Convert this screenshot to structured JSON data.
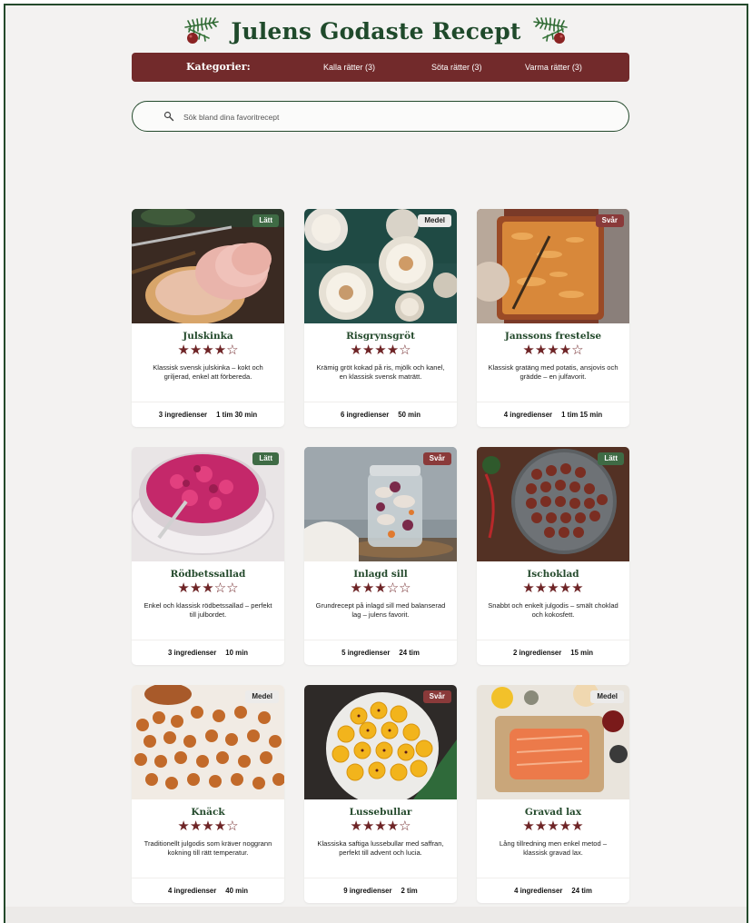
{
  "header": {
    "title": "Julens Godaste Recept"
  },
  "categories": {
    "label": "Kategorier:",
    "items": [
      {
        "label": "Kalla rätter (3)"
      },
      {
        "label": "Söta rätter (3)"
      },
      {
        "label": "Varma rätter (3)"
      }
    ]
  },
  "search": {
    "placeholder": "Sök bland dina favoritrecept",
    "value": ""
  },
  "colors": {
    "green": "#1f4a2b",
    "burgundy": "#722a2b",
    "badge_easy": "#3f6b45",
    "badge_hard": "#8a3a3a"
  },
  "recipes": [
    {
      "name": "Julskinka",
      "difficulty": "Lätt",
      "rating": 4,
      "stars": "★★★★☆",
      "description": "Klassisk svensk julskinka – kokt och griljerad, enkel att förbereda.",
      "ingredients": "3 ingredienser",
      "time": "1 tim 30 min",
      "image": "ham"
    },
    {
      "name": "Risgrynsgröt",
      "difficulty": "Medel",
      "rating": 4,
      "stars": "★★★★☆",
      "description": "Krämig gröt kokad på ris, mjölk och kanel, en klassisk svensk maträtt.",
      "ingredients": "6 ingredienser",
      "time": "50 min",
      "image": "porridge"
    },
    {
      "name": "Janssons frestelse",
      "difficulty": "Svår",
      "rating": 4,
      "stars": "★★★★☆",
      "description": "Klassisk gratäng med potatis, ansjovis och grädde – en julfavorit.",
      "ingredients": "4 ingredienser",
      "time": "1 tim 15 min",
      "image": "gratin"
    },
    {
      "name": "Rödbetssallad",
      "difficulty": "Lätt",
      "rating": 3,
      "stars": "★★★☆☆",
      "description": "Enkel och klassisk rödbetssallad – perfekt till julbordet.",
      "ingredients": "3 ingredienser",
      "time": "10 min",
      "image": "beet"
    },
    {
      "name": "Inlagd sill",
      "difficulty": "Svår",
      "rating": 3,
      "stars": "★★★☆☆",
      "description": "Grundrecept på inlagd sill med balanserad lag – julens favorit.",
      "ingredients": "5 ingredienser",
      "time": "24 tim",
      "image": "herring"
    },
    {
      "name": "Ischoklad",
      "difficulty": "Lätt",
      "rating": 5,
      "stars": "★★★★★",
      "description": "Snabbt och enkelt julgodis – smält choklad och kokosfett.",
      "ingredients": "2 ingredienser",
      "time": "15 min",
      "image": "chocolate"
    },
    {
      "name": "Knäck",
      "difficulty": "Medel",
      "rating": 4,
      "stars": "★★★★☆",
      "description": "Traditionellt julgodis som kräver noggrann kokning till rätt temperatur.",
      "ingredients": "4 ingredienser",
      "time": "40 min",
      "image": "toffee"
    },
    {
      "name": "Lussebullar",
      "difficulty": "Svår",
      "rating": 4,
      "stars": "★★★★☆",
      "description": "Klassiska saftiga lussebullar med saffran, perfekt till advent och lucia.",
      "ingredients": "9 ingredienser",
      "time": "2 tim",
      "image": "buns"
    },
    {
      "name": "Gravad lax",
      "difficulty": "Medel",
      "rating": 5,
      "stars": "★★★★★",
      "description": "Lång tillredning men enkel metod – klassisk gravad lax.",
      "ingredients": "4 ingredienser",
      "time": "24 tim",
      "image": "salmon"
    }
  ]
}
